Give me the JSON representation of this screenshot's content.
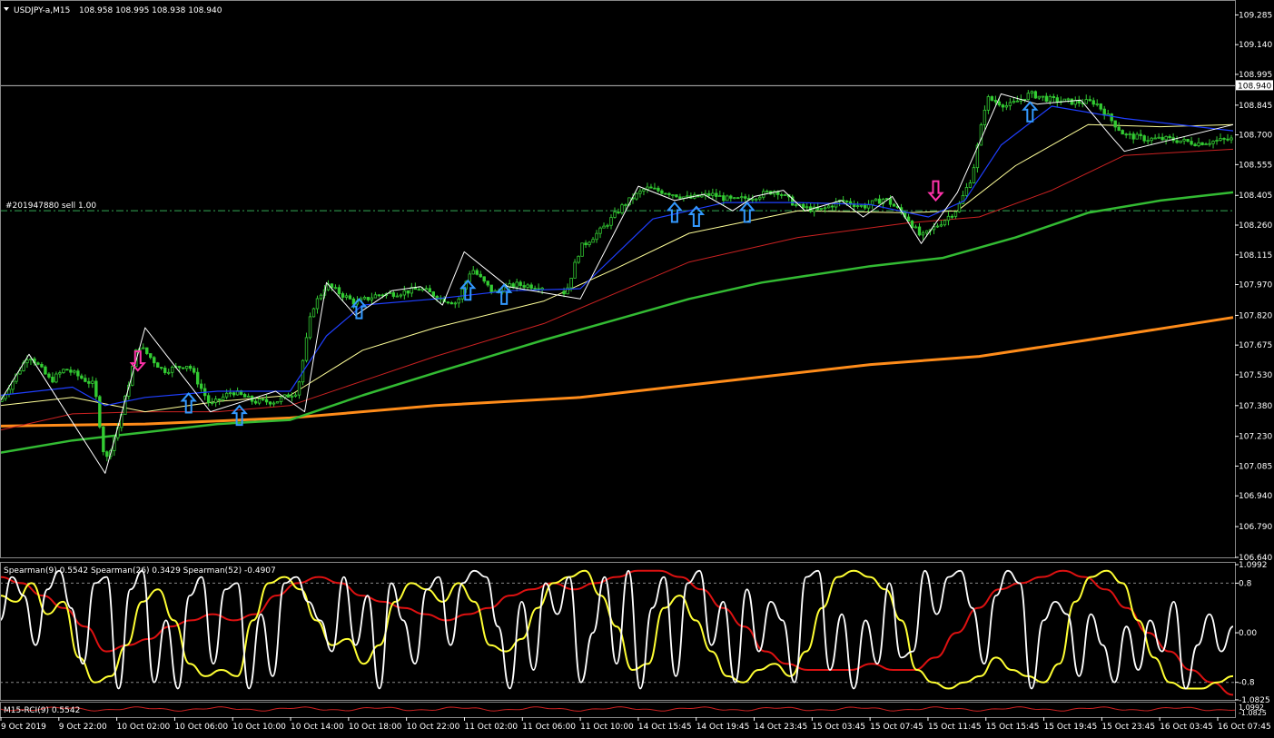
{
  "header": {
    "symbol_title": "USDJPY-a,M15",
    "ohlc": "108.958 108.995 108.938 108.940",
    "order_label": "#201947880 sell 1.00"
  },
  "colors": {
    "background": "#000000",
    "candles": "#33cc33",
    "ma_fast": "#1f3fff",
    "ma_yellow": "#ffff99",
    "ma_red": "#cc2222",
    "ma_green": "#33bb33",
    "ma_orange": "#ff8c1a",
    "zigzag": "#ffffff",
    "arrow_up": "#3399ff",
    "arrow_down": "#ff33aa",
    "order_line": "#33aa55"
  },
  "chart_data": [
    {
      "type": "line",
      "name": "main",
      "ylim": [
        106.64,
        109.34
      ],
      "price_ticks": [
        109.285,
        109.14,
        108.995,
        108.845,
        108.7,
        108.555,
        108.405,
        108.26,
        108.115,
        107.97,
        107.82,
        107.675,
        107.53,
        107.38,
        107.23,
        107.085,
        106.94,
        106.79,
        106.64
      ],
      "current_price": "108.940",
      "order_level": 108.33,
      "x_labels": [
        "9 Oct 2019",
        "9 Oct 22:00",
        "10 Oct 02:00",
        "10 Oct 06:00",
        "10 Oct 10:00",
        "10 Oct 14:00",
        "10 Oct 18:00",
        "10 Oct 22:00",
        "11 Oct 02:00",
        "11 Oct 06:00",
        "11 Oct 10:00",
        "14 Oct 15:45",
        "14 Oct 19:45",
        "14 Oct 23:45",
        "15 Oct 03:45",
        "15 Oct 07:45",
        "15 Oct 11:45",
        "15 Oct 15:45",
        "15 Oct 19:45",
        "15 Oct 23:45",
        "16 Oct 03:45",
        "16 Oct 07:45"
      ],
      "x_range": [
        0,
        340
      ],
      "price_path": [
        [
          0,
          107.4
        ],
        [
          8,
          107.63
        ],
        [
          14,
          107.5
        ],
        [
          18,
          107.56
        ],
        [
          26,
          107.48
        ],
        [
          29,
          107.1
        ],
        [
          33,
          107.3
        ],
        [
          38,
          107.68
        ],
        [
          45,
          107.55
        ],
        [
          52,
          107.58
        ],
        [
          58,
          107.38
        ],
        [
          64,
          107.45
        ],
        [
          70,
          107.4
        ],
        [
          76,
          107.4
        ],
        [
          82,
          107.45
        ],
        [
          86,
          107.85
        ],
        [
          90,
          107.97
        ],
        [
          98,
          107.88
        ],
        [
          104,
          107.92
        ],
        [
          110,
          107.93
        ],
        [
          116,
          107.95
        ],
        [
          122,
          107.9
        ],
        [
          126,
          107.88
        ],
        [
          130,
          108.05
        ],
        [
          136,
          107.93
        ],
        [
          142,
          107.97
        ],
        [
          150,
          107.96
        ],
        [
          156,
          107.93
        ],
        [
          160,
          108.15
        ],
        [
          166,
          108.24
        ],
        [
          172,
          108.36
        ],
        [
          178,
          108.44
        ],
        [
          184,
          108.42
        ],
        [
          190,
          108.39
        ],
        [
          196,
          108.41
        ],
        [
          202,
          108.38
        ],
        [
          208,
          108.4
        ],
        [
          214,
          108.43
        ],
        [
          220,
          108.35
        ],
        [
          226,
          108.33
        ],
        [
          232,
          108.38
        ],
        [
          238,
          108.35
        ],
        [
          244,
          108.39
        ],
        [
          250,
          108.3
        ],
        [
          254,
          108.2
        ],
        [
          260,
          108.28
        ],
        [
          264,
          108.34
        ],
        [
          268,
          108.5
        ],
        [
          272,
          108.88
        ],
        [
          278,
          108.84
        ],
        [
          284,
          108.9
        ],
        [
          290,
          108.87
        ],
        [
          296,
          108.86
        ],
        [
          302,
          108.86
        ],
        [
          306,
          108.78
        ],
        [
          310,
          108.7
        ],
        [
          316,
          108.68
        ],
        [
          322,
          108.68
        ],
        [
          330,
          108.66
        ],
        [
          340,
          108.68
        ]
      ],
      "zigzag": [
        [
          0,
          107.4
        ],
        [
          8,
          107.63
        ],
        [
          29,
          107.05
        ],
        [
          40,
          107.76
        ],
        [
          58,
          107.35
        ],
        [
          76,
          107.45
        ],
        [
          84,
          107.35
        ],
        [
          90,
          107.98
        ],
        [
          98,
          107.82
        ],
        [
          108,
          107.94
        ],
        [
          116,
          107.96
        ],
        [
          122,
          107.87
        ],
        [
          128,
          108.13
        ],
        [
          140,
          107.96
        ],
        [
          160,
          107.9
        ],
        [
          176,
          108.45
        ],
        [
          186,
          108.38
        ],
        [
          194,
          108.41
        ],
        [
          202,
          108.33
        ],
        [
          208,
          108.4
        ],
        [
          216,
          108.43
        ],
        [
          222,
          108.33
        ],
        [
          232,
          108.38
        ],
        [
          238,
          108.3
        ],
        [
          246,
          108.4
        ],
        [
          254,
          108.17
        ],
        [
          264,
          108.42
        ],
        [
          276,
          108.9
        ],
        [
          286,
          108.85
        ],
        [
          298,
          108.87
        ],
        [
          306,
          108.7
        ],
        [
          310,
          108.62
        ],
        [
          340,
          108.75
        ]
      ],
      "ma_fast": [
        [
          0,
          107.43
        ],
        [
          20,
          107.47
        ],
        [
          29,
          107.38
        ],
        [
          40,
          107.42
        ],
        [
          60,
          107.45
        ],
        [
          80,
          107.45
        ],
        [
          90,
          107.72
        ],
        [
          100,
          107.87
        ],
        [
          120,
          107.9
        ],
        [
          140,
          107.94
        ],
        [
          160,
          107.95
        ],
        [
          180,
          108.29
        ],
        [
          200,
          108.37
        ],
        [
          220,
          108.37
        ],
        [
          240,
          108.36
        ],
        [
          256,
          108.3
        ],
        [
          266,
          108.38
        ],
        [
          276,
          108.65
        ],
        [
          290,
          108.84
        ],
        [
          310,
          108.78
        ],
        [
          340,
          108.72
        ]
      ],
      "ma_yellow": [
        [
          0,
          107.38
        ],
        [
          20,
          107.42
        ],
        [
          40,
          107.35
        ],
        [
          60,
          107.4
        ],
        [
          80,
          107.43
        ],
        [
          100,
          107.65
        ],
        [
          120,
          107.76
        ],
        [
          150,
          107.89
        ],
        [
          170,
          108.05
        ],
        [
          190,
          108.22
        ],
        [
          220,
          108.33
        ],
        [
          250,
          108.32
        ],
        [
          264,
          108.33
        ],
        [
          280,
          108.55
        ],
        [
          300,
          108.75
        ],
        [
          320,
          108.74
        ],
        [
          340,
          108.75
        ]
      ],
      "ma_red": [
        [
          0,
          107.26
        ],
        [
          20,
          107.34
        ],
        [
          40,
          107.35
        ],
        [
          60,
          107.35
        ],
        [
          80,
          107.38
        ],
        [
          100,
          107.5
        ],
        [
          120,
          107.62
        ],
        [
          150,
          107.78
        ],
        [
          170,
          107.93
        ],
        [
          190,
          108.08
        ],
        [
          220,
          108.2
        ],
        [
          250,
          108.27
        ],
        [
          270,
          108.3
        ],
        [
          290,
          108.43
        ],
        [
          310,
          108.6
        ],
        [
          340,
          108.63
        ]
      ],
      "ma_green": [
        [
          0,
          107.15
        ],
        [
          20,
          107.21
        ],
        [
          40,
          107.25
        ],
        [
          60,
          107.29
        ],
        [
          80,
          107.31
        ],
        [
          100,
          107.43
        ],
        [
          120,
          107.54
        ],
        [
          150,
          107.7
        ],
        [
          170,
          107.8
        ],
        [
          190,
          107.9
        ],
        [
          210,
          107.98
        ],
        [
          240,
          108.06
        ],
        [
          260,
          108.1
        ],
        [
          280,
          108.2
        ],
        [
          300,
          108.32
        ],
        [
          320,
          108.38
        ],
        [
          340,
          108.42
        ]
      ],
      "ma_orange": [
        [
          0,
          107.28
        ],
        [
          40,
          107.29
        ],
        [
          80,
          107.32
        ],
        [
          120,
          107.38
        ],
        [
          160,
          107.42
        ],
        [
          200,
          107.5
        ],
        [
          240,
          107.58
        ],
        [
          270,
          107.62
        ],
        [
          300,
          107.7
        ],
        [
          340,
          107.81
        ]
      ],
      "arrows_up": [
        [
          52,
          107.39
        ],
        [
          66,
          107.33
        ],
        [
          99,
          107.85
        ],
        [
          129,
          107.94
        ],
        [
          139,
          107.92
        ],
        [
          186,
          108.32
        ],
        [
          192,
          108.3
        ],
        [
          206,
          108.32
        ],
        [
          284,
          108.81
        ]
      ],
      "arrows_down": [
        [
          38,
          107.6
        ],
        [
          258,
          108.43
        ]
      ]
    },
    {
      "type": "line",
      "name": "spearman",
      "title": "Spearman(9) 0.5542  Spearman(26) 0.3429  Spearman(52) -0.4907",
      "ylim": [
        -1.0825,
        1.0992
      ],
      "ticks": [
        "1.0992",
        "0.8",
        "0.00",
        "-0.8",
        "-1.0825"
      ],
      "levels": [
        0.8,
        -0.8
      ],
      "series": [
        {
          "name": "Spearman(9)",
          "color": "#ffffff",
          "values": [
            0.2,
            0.9,
            0.6,
            -0.2,
            0.7,
            1.0,
            0.4,
            -0.5,
            0.8,
            0.9,
            -0.9,
            0.7,
            1.0,
            -0.8,
            0.2,
            -0.9,
            0.6,
            0.9,
            -0.5,
            0.7,
            0.8,
            -0.9,
            0.3,
            -0.7,
            0.8,
            0.9,
            0.5,
            0.2,
            -0.3,
            0.9,
            -0.2,
            0.6,
            -0.9,
            0.8,
            0.2,
            -0.5,
            0.7,
            0.9,
            -0.2,
            0.8,
            1.0,
            0.9,
            0.1,
            -0.9,
            0.5,
            -0.6,
            0.8,
            0.3,
            0.9,
            -0.8,
            0.0,
            0.9,
            -0.5,
            1.0,
            -0.9,
            0.4,
            0.9,
            -0.7,
            0.8,
            1.0,
            -0.2,
            0.5,
            -0.8,
            0.7,
            -0.3,
            0.5,
            0.2,
            -0.8,
            0.9,
            1.0,
            -0.6,
            0.3,
            -0.9,
            0.2,
            -0.5,
            0.8,
            -0.4,
            -0.3,
            1.0,
            0.3,
            0.9,
            1.0,
            0.4,
            -0.5,
            0.6,
            1.0,
            0.8,
            -0.9,
            0.2,
            0.5,
            0.3,
            -0.7,
            0.3,
            -0.2,
            -0.8,
            0.1,
            -0.6,
            0.2,
            -0.3,
            0.5,
            -0.9,
            -0.2,
            0.3,
            -0.3,
            0.1
          ]
        },
        {
          "name": "Spearman(26)",
          "color": "#ffff33",
          "values": [
            0.6,
            0.5,
            0.8,
            0.3,
            0.5,
            -0.4,
            -0.8,
            -0.7,
            -0.2,
            0.5,
            0.7,
            0.2,
            -0.5,
            -0.7,
            -0.6,
            -0.7,
            0.2,
            0.8,
            0.9,
            0.7,
            0.2,
            -0.2,
            -0.1,
            -0.5,
            -0.2,
            0.5,
            0.8,
            0.7,
            0.5,
            0.8,
            0.5,
            -0.2,
            -0.3,
            -0.1,
            0.4,
            0.8,
            0.9,
            1.0,
            0.6,
            0.1,
            -0.6,
            -0.5,
            0.4,
            0.6,
            0.2,
            -0.3,
            -0.7,
            -0.8,
            -0.6,
            -0.5,
            -0.7,
            -0.3,
            0.4,
            0.9,
            1.0,
            0.9,
            0.7,
            0.2,
            -0.6,
            -0.8,
            -0.9,
            -0.8,
            -0.7,
            -0.4,
            -0.6,
            -0.7,
            -0.8,
            -0.5,
            0.5,
            0.9,
            1.0,
            0.8,
            0.2,
            -0.4,
            -0.8,
            -0.9,
            -0.9,
            -0.8,
            -0.7
          ]
        },
        {
          "name": "Spearman(52)",
          "color": "#dd1111",
          "values": [
            0.9,
            0.8,
            0.6,
            0.4,
            0.1,
            -0.3,
            -0.2,
            -0.1,
            0.1,
            0.2,
            0.3,
            0.2,
            0.3,
            0.6,
            0.8,
            0.9,
            0.8,
            0.6,
            0.5,
            0.4,
            0.3,
            0.2,
            0.3,
            0.4,
            0.6,
            0.7,
            0.8,
            0.7,
            0.8,
            0.9,
            1.0,
            1.0,
            0.9,
            0.7,
            0.4,
            0.1,
            -0.3,
            -0.5,
            -0.6,
            -0.6,
            -0.6,
            -0.5,
            -0.6,
            -0.6,
            -0.4,
            0.0,
            0.4,
            0.7,
            0.8,
            0.9,
            1.0,
            0.9,
            0.7,
            0.4,
            0.0,
            -0.3,
            -0.6,
            -0.8,
            -1.0
          ]
        }
      ]
    },
    {
      "type": "line",
      "name": "rci",
      "title": "M15-RCI(9) 0.5542",
      "ticks": [
        "1.0992",
        "-1.0825"
      ]
    }
  ]
}
